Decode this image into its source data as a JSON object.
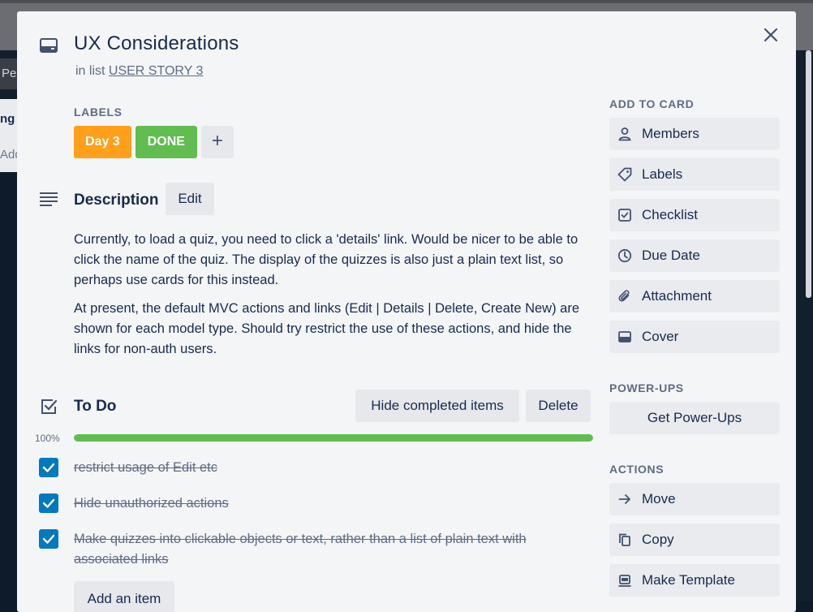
{
  "background": {
    "chip_text": "Pe",
    "list_title": "ng",
    "list_add": "Add"
  },
  "card": {
    "title": "UX Considerations",
    "in_list_prefix": "in list",
    "list_name": "USER STORY 3"
  },
  "labels": {
    "heading": "LABELS",
    "items": [
      {
        "text": "Day 3",
        "color": "#ff9f1a"
      },
      {
        "text": "DONE",
        "color": "#61bd4f"
      }
    ],
    "add_symbol": "+"
  },
  "description": {
    "heading": "Description",
    "edit_label": "Edit",
    "paragraphs": [
      "Currently, to load a quiz, you need to click a 'details' link. Would be nicer to be able to click the name of the quiz. The display of the quizzes is also just a plain text list, so perhaps use cards for this instead.",
      "At present, the default MVC actions and links (Edit | Details | Delete, Create New) are shown for each model type. Should try restrict the use of these actions, and hide the links for non-auth users."
    ]
  },
  "checklist": {
    "heading": "To Do",
    "hide_completed_label": "Hide completed items",
    "delete_label": "Delete",
    "progress_text": "100%",
    "progress_fraction": 1.0,
    "progress_color": "#61bd4f",
    "items": [
      {
        "text": "restrict usage of Edit etc",
        "checked": true
      },
      {
        "text": "Hide unauthorized actions",
        "checked": true
      },
      {
        "text": "Make quizzes into clickable objects or text, rather than a list of plain text with associated links",
        "checked": true
      }
    ],
    "add_item_label": "Add an item"
  },
  "sidebar": {
    "add_to_card_heading": "ADD TO CARD",
    "add_to_card": [
      {
        "label": "Members",
        "icon": "person-icon"
      },
      {
        "label": "Labels",
        "icon": "tag-icon"
      },
      {
        "label": "Checklist",
        "icon": "checkbox-icon"
      },
      {
        "label": "Due Date",
        "icon": "clock-icon"
      },
      {
        "label": "Attachment",
        "icon": "paperclip-icon"
      },
      {
        "label": "Cover",
        "icon": "cover-icon"
      }
    ],
    "power_ups_heading": "POWER-UPS",
    "get_power_ups_label": "Get Power-Ups",
    "actions_heading": "ACTIONS",
    "actions": [
      {
        "label": "Move",
        "icon": "arrow-right-icon"
      },
      {
        "label": "Copy",
        "icon": "copy-icon"
      },
      {
        "label": "Make Template",
        "icon": "template-icon"
      }
    ]
  },
  "colors": {
    "checkbox": "#0079bf",
    "modal_bg": "#f4f5f7",
    "button_bg": "#e9ebef"
  }
}
